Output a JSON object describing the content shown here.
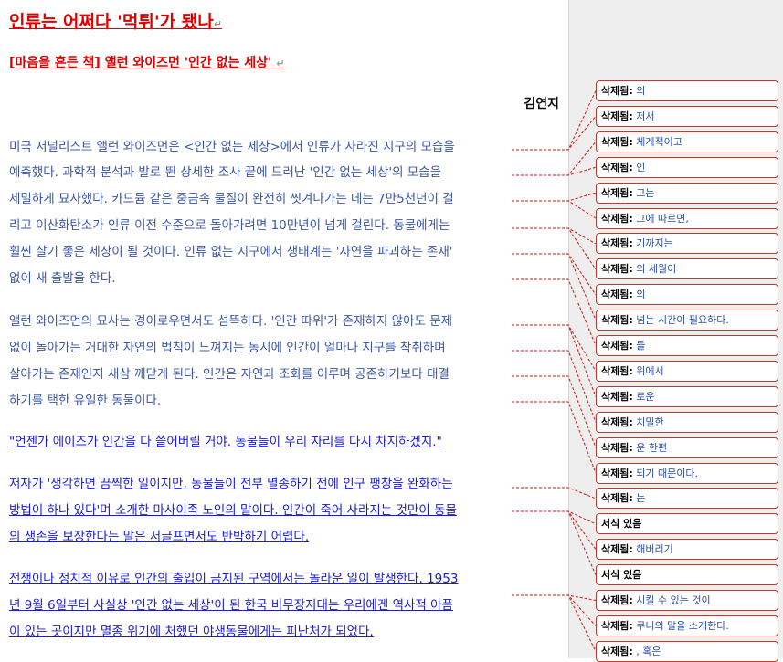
{
  "title": "인류는 어쩌다 '먹튀'가 됐나",
  "subtitle": "[마음을 흔든 책] 앨런 와이즈먼 '인간 없는 세상'",
  "author": "김연지",
  "paragraph_mark": "↵",
  "lines": [
    "미국 저널리스트 앨런 와이즈먼은 <인간 없는 세상>에서 인류가 사라진 지구의 모습을",
    "예측했다. 과학적 분석과 발로 뛴 상세한 조사 끝에 드러난 '인간 없는 세상'의 모습을",
    "세밀하게 묘사했다. 카드뮴 같은 중금속 물질이 완전히 씻겨나가는 데는 7만5천년이 걸",
    "리고 이산화탄소가 인류 이전 수준으로 돌아가려면 10만년이 넘게 걸린다. 동물에게는",
    "훨씬 살기 좋은 세상이 될 것이다. 인류 없는 지구에서 생태계는 '자연을 파괴하는 존재'",
    "없이 새 출발을 한다.",
    "앨런 와이즈먼의 묘사는 경이로우면서도 섬뜩하다. '인간 따위'가 존재하지 않아도 문제",
    "없이 돌아가는 거대한 자연의 법칙이 느껴지는 동시에 인간이 얼마나 지구를 착취하며",
    "살아가는 존재인지 새삼 깨닫게 된다. 인간은 자연과 조화를 이루며 공존하기보다 대결",
    "하기를 택한 유일한 동물이다.",
    "\"언젠가 에이즈가 인간을 다 쓸어버릴 거야. 동물들이 우리 자리를 다시 차지하겠지.\"",
    "저자가 '생각하면 끔찍한 일이지만, 동물들이 전부 멸종하기 전에 인구 팽창을 완화하는",
    "방법이 하나 있다'며 소개한 마사이족 노인의 말이다. 인간이 죽어 사라지는 것만이 동물",
    "의 생존을 보장한다는 말은 서글프면서도 반박하기 어렵다.",
    "전쟁이나 정치적 이유로 인간의 출입이 금지된 구역에서는 놀라운 일이 발생한다. 1953",
    "년 9월 6일부터 사실상 '인간 없는 세상'이 된 한국 비무장지대는 우리에겐 역사적 아픔",
    "이 있는 곳이지만 멸종 위기에 처했던 야생동물에게는 피난처가 되었다."
  ],
  "comments": [
    {
      "label": "삭제됨:",
      "text": "의"
    },
    {
      "label": "삭제됨:",
      "text": "저서"
    },
    {
      "label": "삭제됨:",
      "text": "체계적이고"
    },
    {
      "label": "삭제됨:",
      "text": "인"
    },
    {
      "label": "삭제됨:",
      "text": "그는"
    },
    {
      "label": "삭제됨:",
      "text": "그에 따르면,"
    },
    {
      "label": "삭제됨:",
      "text": "기까지는"
    },
    {
      "label": "삭제됨:",
      "text": "의 세월이"
    },
    {
      "label": "삭제됨:",
      "text": "의"
    },
    {
      "label": "삭제됨:",
      "text": "넘는 시간이 필요하다."
    },
    {
      "label": "삭제됨:",
      "text": "들"
    },
    {
      "label": "삭제됨:",
      "text": " 위에서"
    },
    {
      "label": "삭제됨:",
      "text": "로운"
    },
    {
      "label": "삭제됨:",
      "text": "치밀한"
    },
    {
      "label": "삭제됨:",
      "text": "운 한편"
    },
    {
      "label": "삭제됨:",
      "text": "되기 때문이다."
    },
    {
      "label": "삭제됨:",
      "text": "는"
    },
    {
      "label": "서식 있음",
      "text": ""
    },
    {
      "label": "삭제됨:",
      "text": "해버리기"
    },
    {
      "label": "서식 있음",
      "text": ""
    },
    {
      "label": "삭제됨:",
      "text": "시킬 수 있는 것이"
    },
    {
      "label": "삭제됨:",
      "text": "쿠니의 말을 소개한다."
    },
    {
      "label": "삭제됨:",
      "text": ", 혹은"
    }
  ],
  "colors": {
    "insert_red": "#e00000",
    "text_blue": "#3a56a8",
    "balloon_border": "#c0392b"
  }
}
